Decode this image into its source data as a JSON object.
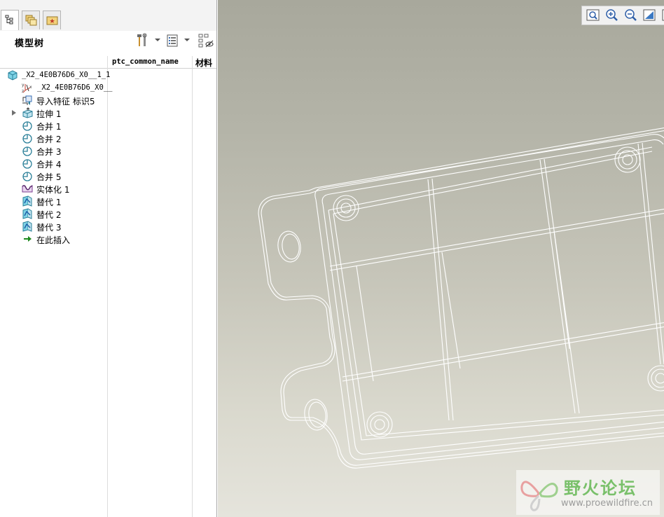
{
  "left_panel": {
    "title": "模型树",
    "columns": {
      "common_name": "ptc_common_name",
      "material": "材料"
    }
  },
  "tree": [
    {
      "label": "_X2_4E0B76D6_X0__1_1",
      "icon": "part-icon"
    },
    {
      "label": "_X2_4E0B76D6_X0__",
      "icon": "csys-icon"
    },
    {
      "label": "导入特征 标识5",
      "icon": "import-feature-icon"
    },
    {
      "label": "拉伸 1",
      "icon": "extrude-icon"
    },
    {
      "label": "合并 1",
      "icon": "merge-icon"
    },
    {
      "label": "合并 2",
      "icon": "merge-icon"
    },
    {
      "label": "合并 3",
      "icon": "merge-icon"
    },
    {
      "label": "合并 4",
      "icon": "merge-icon"
    },
    {
      "label": "合并 5",
      "icon": "merge-icon"
    },
    {
      "label": "实体化 1",
      "icon": "solidify-icon"
    },
    {
      "label": "替代 1",
      "icon": "replace-icon"
    },
    {
      "label": "替代 2",
      "icon": "replace-icon"
    },
    {
      "label": "替代 3",
      "icon": "replace-icon"
    },
    {
      "label": "在此插入",
      "icon": "insert-here-icon"
    }
  ],
  "watermark": {
    "text_cn": "野火论坛",
    "url": "www.proewildfire.cn"
  },
  "colors": {
    "viewport_top": "#a8a89c",
    "viewport_bottom": "#e5e4dc",
    "insert_arrow": "#1f8a1f",
    "watermark_green": "#79c06a"
  }
}
